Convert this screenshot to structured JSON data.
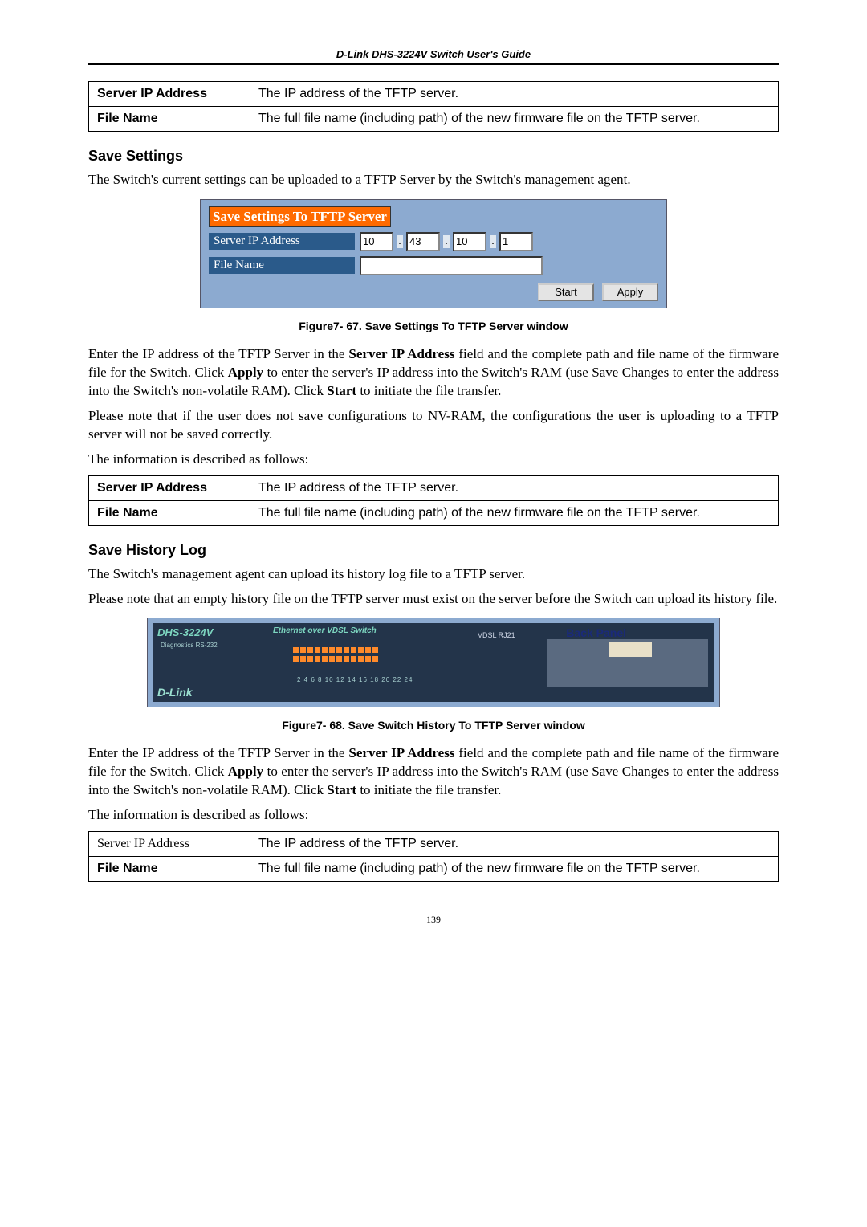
{
  "header": "D-Link DHS-3224V Switch User's Guide",
  "page_number": "139",
  "table1": {
    "r1_label": "Server IP Address",
    "r1_value": "The IP address of the TFTP server.",
    "r2_label": "File Name",
    "r2_value": "The full file name (including path) of the new firmware file on the TFTP server."
  },
  "save_settings": {
    "heading": "Save Settings",
    "intro": "The Switch's current settings can be uploaded to a TFTP Server by the Switch's management agent.",
    "fig_title": "Save Settings To TFTP Server",
    "label_ip": "Server IP Address",
    "label_file": "File Name",
    "ip": {
      "o1": "10",
      "o2": "43",
      "o3": "10",
      "o4": "1"
    },
    "btn_start": "Start",
    "btn_apply": "Apply",
    "caption": "Figure7- 67.  Save Settings To TFTP Server window",
    "para1_a": "Enter the IP address of the TFTP Server in the ",
    "para1_b": "Server IP Address",
    "para1_c": " field and the complete path and file name of the firmware file for the Switch. Click ",
    "para1_d": "Apply",
    "para1_e": " to enter the server's IP address into the Switch's RAM (use Save Changes to enter the address into the Switch's non-volatile RAM). Click ",
    "para1_f": "Start",
    "para1_g": " to initiate the file transfer.",
    "para2": "Please note that if the user does not save configurations to NV-RAM, the configurations the user is uploading to a TFTP server will not be saved correctly.",
    "para3": "The information is described as follows:"
  },
  "table2": {
    "r1_label": "Server IP Address",
    "r1_value": "The IP address of the TFTP server.",
    "r2_label": "File Name",
    "r2_value": "The full file name (including path) of the new firmware file on the TFTP server."
  },
  "save_history": {
    "heading": "Save History Log",
    "intro": "The Switch's management agent can upload its history log file to a TFTP server.",
    "note": "Please note that an empty history file on the TFTP server must exist on the server before the Switch can upload its history file.",
    "caption": "Figure7- 68.  Save Switch History To TFTP Server window",
    "para1_a": "Enter the IP address of the TFTP Server in the ",
    "para1_b": "Server IP Address",
    "para1_c": " field and the complete path and file name of the firmware file for the Switch. Click ",
    "para1_d": "Apply",
    "para1_e": " to enter the server's IP address into the Switch's RAM (use Save Changes to enter the address into the Switch's non-volatile RAM). Click ",
    "para1_f": "Start",
    "para1_g": " to initiate the file transfer.",
    "para2": "The information is described as follows:"
  },
  "table3": {
    "r1_label": "Server IP Address",
    "r1_value": "The IP address of the TFTP server.",
    "r2_label": "File Name",
    "r2_value": "The full file name (including path) of the new firmware file on the TFTP server."
  },
  "fig68": {
    "model": "DHS-3224V",
    "ethlabel": "Ethernet over VDSL Switch",
    "brand": "D-Link",
    "backpanel": "Back Panel",
    "vdsl": "VDSL  RJ21",
    "ports": "2  4  6  8 10 12  14 16 18 20 22 24",
    "diag": "Diagnostics RS-232"
  }
}
